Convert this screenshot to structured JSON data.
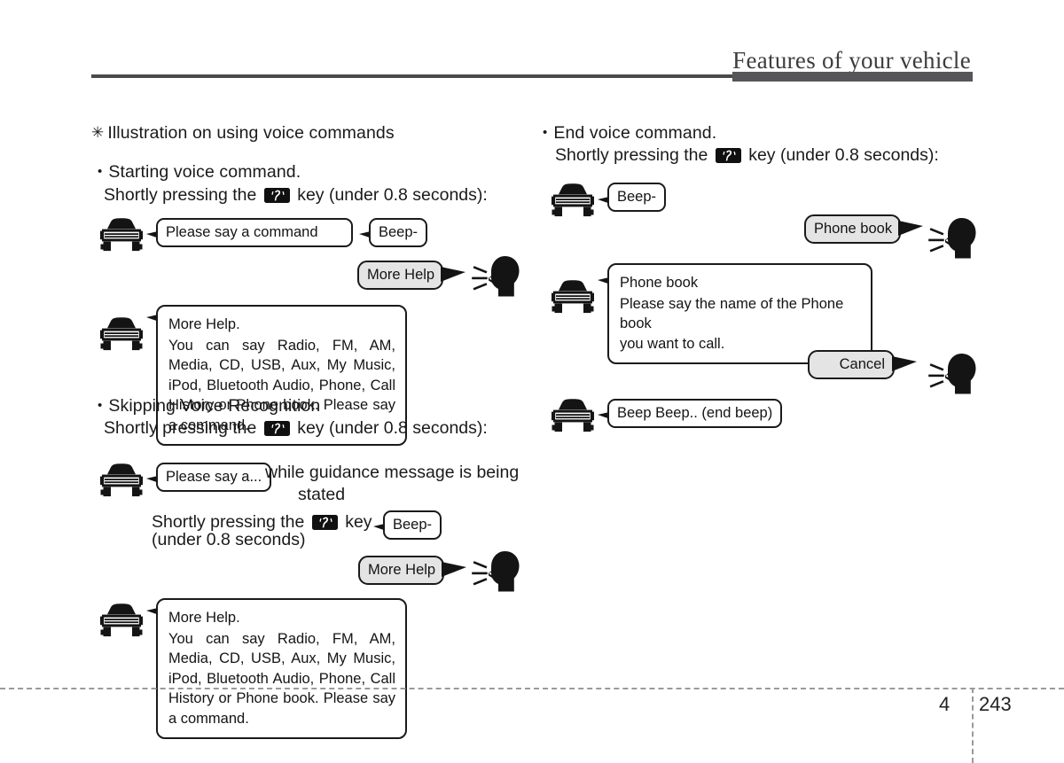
{
  "header": {
    "title": "Features of your vehicle"
  },
  "footer": {
    "chapter": "4",
    "page": "243"
  },
  "symbols": {
    "asterisk": "✳",
    "bullet": "•",
    "voice_key_name": "voice-recognition-key"
  },
  "left_column": {
    "section_title": "Illustration on using voice commands",
    "blocks": [
      {
        "bullet_heading": "Starting voice command.",
        "instruction_before": "Shortly pressing the",
        "instruction_after": "key (under 0.8 seconds):",
        "car_bubble_1": "Please say a command",
        "beep_bubble": "Beep-",
        "user_bubble": "More Help",
        "help_bubble_title": "More Help.",
        "help_bubble_body": "You can say Radio, FM, AM, Media, CD, USB, Aux, My Music, iPod, Bluetooth Audio, Phone, Call History or Phone book. Please say a command."
      },
      {
        "bullet_heading": "Skipping Voice Recognition",
        "instruction_before": "Shortly pressing the",
        "instruction_after": "key (under 0.8 seconds):",
        "car_bubble_1": "Please say a...",
        "side_note_line1": "while guidance message is being",
        "side_note_line2": "stated",
        "second_instruction_before": "Shortly pressing the",
        "second_instruction_after": "key",
        "second_instruction_line2": "(under 0.8 seconds)",
        "beep_bubble": "Beep-",
        "user_bubble": "More Help",
        "help_bubble_title": "More Help.",
        "help_bubble_body": "You can say Radio, FM, AM, Media, CD, USB, Aux, My Music, iPod, Bluetooth Audio, Phone, Call History or Phone book. Please say a command."
      }
    ]
  },
  "right_column": {
    "bullet_heading": "End voice command.",
    "instruction_before": "Shortly pressing the",
    "instruction_after": "key (under 0.8 seconds):",
    "beep_bubble": "Beep-",
    "user_bubble_1": "Phone book",
    "car_bubble_title": "Phone book",
    "car_bubble_body_line1": "Please say the name of the Phone book",
    "car_bubble_body_line2": "you want to call.",
    "user_bubble_2": "Cancel",
    "final_beep_bubble": "Beep Beep.. (end beep)"
  }
}
